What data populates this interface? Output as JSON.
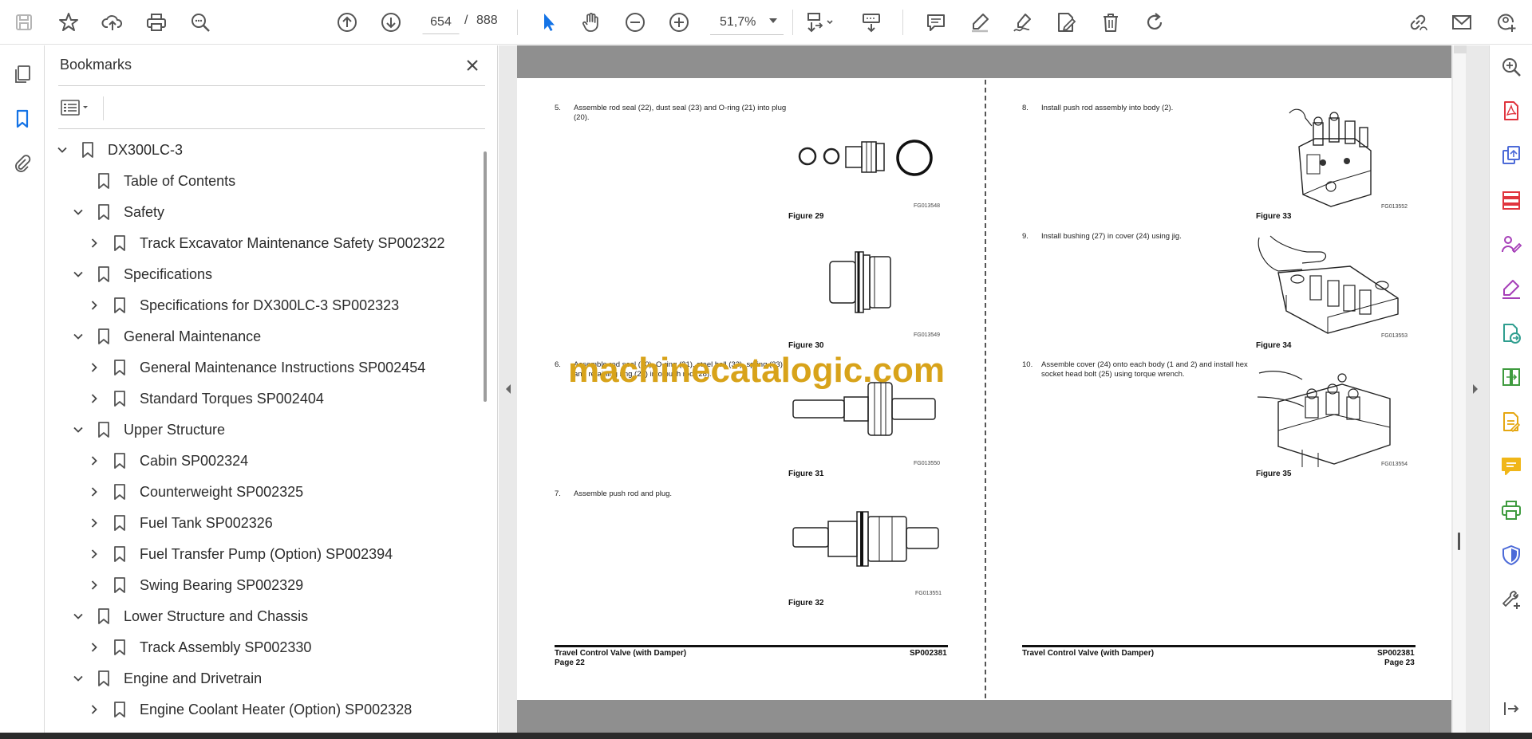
{
  "toolbar": {
    "current_page": "654",
    "page_separator": "/",
    "total_pages": "888",
    "zoom": "51,7%"
  },
  "bookmarks_panel": {
    "title": "Bookmarks",
    "items": [
      {
        "label": "DX300LC-3",
        "level": 0,
        "state": "expanded"
      },
      {
        "label": "Table of Contents",
        "level": 1,
        "state": "leaf"
      },
      {
        "label": "Safety",
        "level": 1,
        "state": "expanded"
      },
      {
        "label": "Track Excavator Maintenance Safety SP002322",
        "level": 2,
        "state": "collapsed"
      },
      {
        "label": "Specifications",
        "level": 1,
        "state": "expanded"
      },
      {
        "label": "Specifications for DX300LC-3 SP002323",
        "level": 2,
        "state": "collapsed"
      },
      {
        "label": "General Maintenance",
        "level": 1,
        "state": "expanded"
      },
      {
        "label": "General Maintenance Instructions SP002454",
        "level": 2,
        "state": "collapsed"
      },
      {
        "label": "Standard Torques SP002404",
        "level": 2,
        "state": "collapsed"
      },
      {
        "label": "Upper Structure",
        "level": 1,
        "state": "expanded"
      },
      {
        "label": "Cabin SP002324",
        "level": 2,
        "state": "collapsed"
      },
      {
        "label": "Counterweight SP002325",
        "level": 2,
        "state": "collapsed"
      },
      {
        "label": "Fuel Tank SP002326",
        "level": 2,
        "state": "collapsed"
      },
      {
        "label": "Fuel Transfer Pump (Option) SP002394",
        "level": 2,
        "state": "collapsed"
      },
      {
        "label": "Swing Bearing SP002329",
        "level": 2,
        "state": "collapsed"
      },
      {
        "label": "Lower Structure and Chassis",
        "level": 1,
        "state": "expanded"
      },
      {
        "label": "Track Assembly SP002330",
        "level": 2,
        "state": "collapsed"
      },
      {
        "label": "Engine and Drivetrain",
        "level": 1,
        "state": "expanded"
      },
      {
        "label": "Engine Coolant Heater (Option) SP002328",
        "level": 2,
        "state": "collapsed"
      }
    ]
  },
  "document": {
    "left_page": {
      "steps": [
        {
          "num": "5.",
          "text": "Assemble rod seal (22), dust seal (23) and O-ring (21) into plug (20)."
        },
        {
          "num": "6.",
          "text": "Assemble rod seal (30), O-ring (31), steel ball (32), spring (33) and retaining ring (29) into push rod (28)."
        },
        {
          "num": "7.",
          "text": "Assemble push rod and plug."
        }
      ],
      "figures": [
        {
          "caption": "Figure 29",
          "code": "FG013548"
        },
        {
          "caption": "Figure 30",
          "code": "FG013549"
        },
        {
          "caption": "Figure 31",
          "code": "FG013550"
        },
        {
          "caption": "Figure 32",
          "code": "FG013551"
        }
      ],
      "footer_title": "Travel Control Valve (with Damper)",
      "footer_page": "Page 22",
      "footer_code": "SP002381"
    },
    "right_page": {
      "steps": [
        {
          "num": "8.",
          "text": "Install push rod assembly into body (2)."
        },
        {
          "num": "9.",
          "text": "Install bushing (27) in cover (24) using jig."
        },
        {
          "num": "10.",
          "text": "Assemble cover (24) onto each body (1 and 2) and install hex socket head bolt (25) using torque wrench."
        }
      ],
      "figures": [
        {
          "caption": "Figure 33",
          "code": "FG013552"
        },
        {
          "caption": "Figure 34",
          "code": "FG013553"
        },
        {
          "caption": "Figure 35",
          "code": "FG013554"
        }
      ],
      "footer_title": "Travel Control Valve (with Damper)",
      "footer_page": "Page 23",
      "footer_code": "SP002381"
    },
    "watermark": "machinecatalogic.com"
  },
  "colors": {
    "accent_blue": "#1473e6",
    "watermark": "#d8a31a",
    "page_band": "#8f8f8f"
  }
}
